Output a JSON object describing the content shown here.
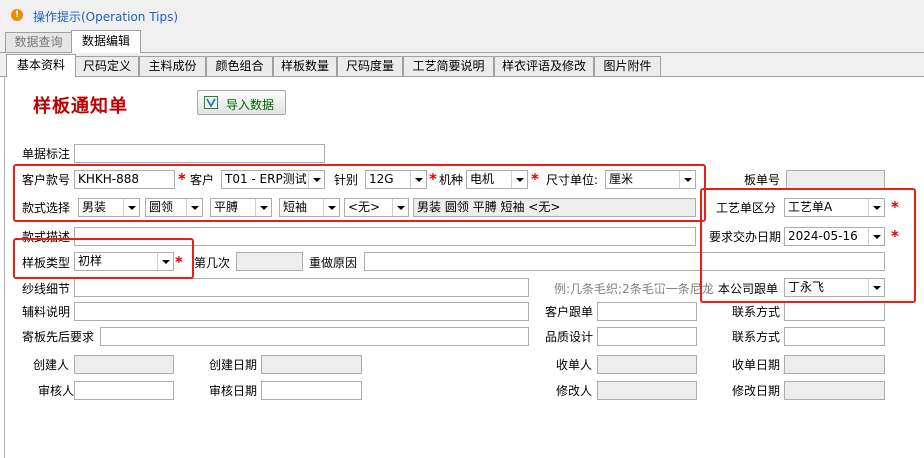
{
  "tips": {
    "label": "操作提示(Operation Tips)",
    "icon": "warning-icon"
  },
  "top_tabs": [
    "数据查询",
    "数据编辑"
  ],
  "sub_tabs": [
    "基本资料",
    "尺码定义",
    "主料成份",
    "颜色组合",
    "样板数量",
    "尺码度量",
    "工艺简要说明",
    "样衣评语及修改",
    "图片附件"
  ],
  "form_title": "样板通知单",
  "import_button": "导入数据",
  "labels": {
    "doc_mark": "单据标注",
    "cust_style": "客户款号",
    "customer": "客户",
    "needle": "针别",
    "machine": "机种",
    "size_unit": "尺寸单位:",
    "board_no": "板单号",
    "style_select": "款式选择",
    "craft_type": "工艺单区分",
    "style_desc": "款式描述",
    "due_date": "要求交办日期",
    "sample_type": "样板类型",
    "nth_time": "第几次",
    "redo_reason": "重做原因",
    "yarn_detail": "纱线细节",
    "company_follow": "本公司跟单",
    "aux_desc": "辅料说明",
    "cust_follow": "客户跟单",
    "contact1": "联系方式",
    "send_req": "寄板先后要求",
    "qc_design": "品质设计",
    "contact2": "联系方式",
    "creator": "创建人",
    "create_date": "创建日期",
    "receiver": "收单人",
    "receive_date": "收单日期",
    "reviewer": "审核人",
    "review_date": "审核日期",
    "modifier": "修改人",
    "modify_date": "修改日期"
  },
  "values": {
    "cust_style": "KHKH-888",
    "customer": "T01 - ERP测试",
    "needle": "12G",
    "machine": "电机",
    "size_unit": "厘米",
    "style_options": [
      "男装",
      "圆领",
      "平膊",
      "短袖",
      "<无>"
    ],
    "style_summary": "男装  圆领  平膊  短袖  <无>",
    "craft_type": "工艺单A",
    "due_date": "2024-05-16",
    "sample_type": "初样",
    "yarn_hint": "例:几条毛织;2条毛冚一条尼龙",
    "company_follow": "丁永飞"
  },
  "colors": {
    "highlight": "#e8201a",
    "title": "#c00000",
    "required_star": "#e00000"
  }
}
